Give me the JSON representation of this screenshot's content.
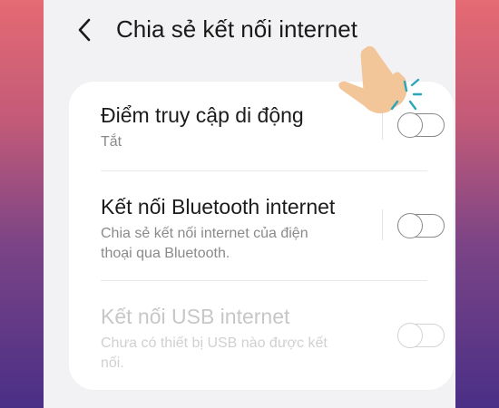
{
  "header": {
    "title": "Chia sẻ kết nối internet"
  },
  "settings": [
    {
      "label": "Điểm truy cập di động",
      "sub": "Tắt",
      "enabled": true,
      "toggle_on": false
    },
    {
      "label": "Kết nối Bluetooth internet",
      "sub_line1": "Chia sẻ kết nối internet của điện",
      "sub_line2": "thoại qua Bluetooth.",
      "enabled": true,
      "toggle_on": false
    },
    {
      "label": "Kết nối USB internet",
      "sub_line1": "Chưa có thiết bị USB nào được kết",
      "sub_line2": "nối.",
      "enabled": false,
      "toggle_on": false
    }
  ],
  "colors": {
    "skin": "#f3c69a",
    "tap_marks": "#2aa6b8",
    "background_top": "#e56a73",
    "background_bottom": "#4a2f86"
  }
}
